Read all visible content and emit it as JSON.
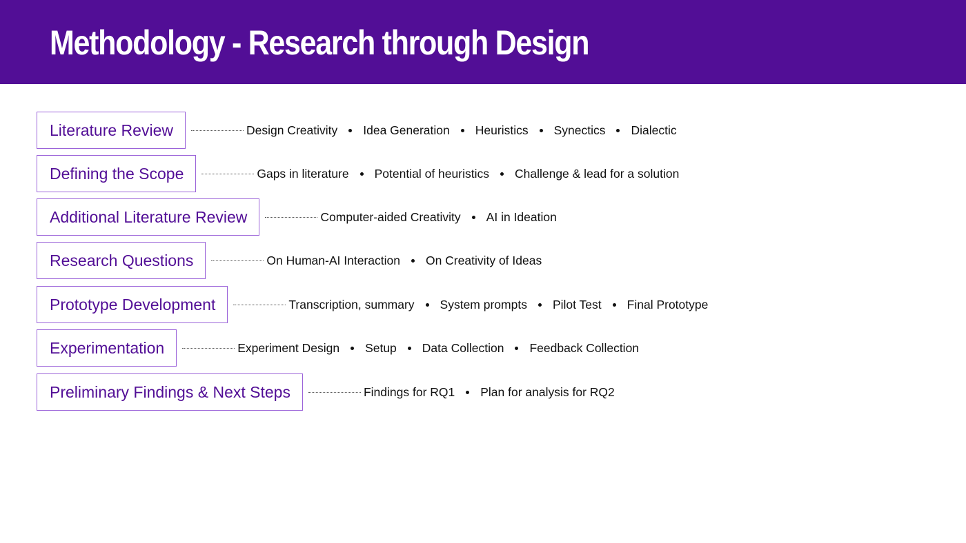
{
  "title": "Methodology - Research through Design",
  "colors": {
    "header_bg": "#520e96",
    "stage_text": "#520e96",
    "stage_border": "#9b63d9"
  },
  "stages": [
    {
      "label": "Literature Review",
      "items": [
        "Design Creativity",
        "Idea Generation",
        "Heuristics",
        "Synectics",
        "Dialectic"
      ]
    },
    {
      "label": "Defining the Scope",
      "items": [
        "Gaps in literature",
        "Potential of heuristics",
        "Challenge & lead for a solution"
      ]
    },
    {
      "label": "Additional Literature Review",
      "items": [
        "Computer-aided Creativity",
        "AI in Ideation"
      ]
    },
    {
      "label": "Research Questions",
      "items": [
        "On Human-AI Interaction",
        "On Creativity of Ideas"
      ]
    },
    {
      "label": "Prototype Development",
      "items": [
        "Transcription, summary",
        "System prompts",
        "Pilot Test",
        "Final Prototype"
      ]
    },
    {
      "label": "Experimentation",
      "items": [
        "Experiment Design",
        "Setup",
        "Data Collection",
        "Feedback Collection"
      ]
    },
    {
      "label": "Preliminary Findings & Next Steps",
      "items": [
        "Findings for RQ1",
        "Plan for analysis for RQ2"
      ]
    }
  ]
}
